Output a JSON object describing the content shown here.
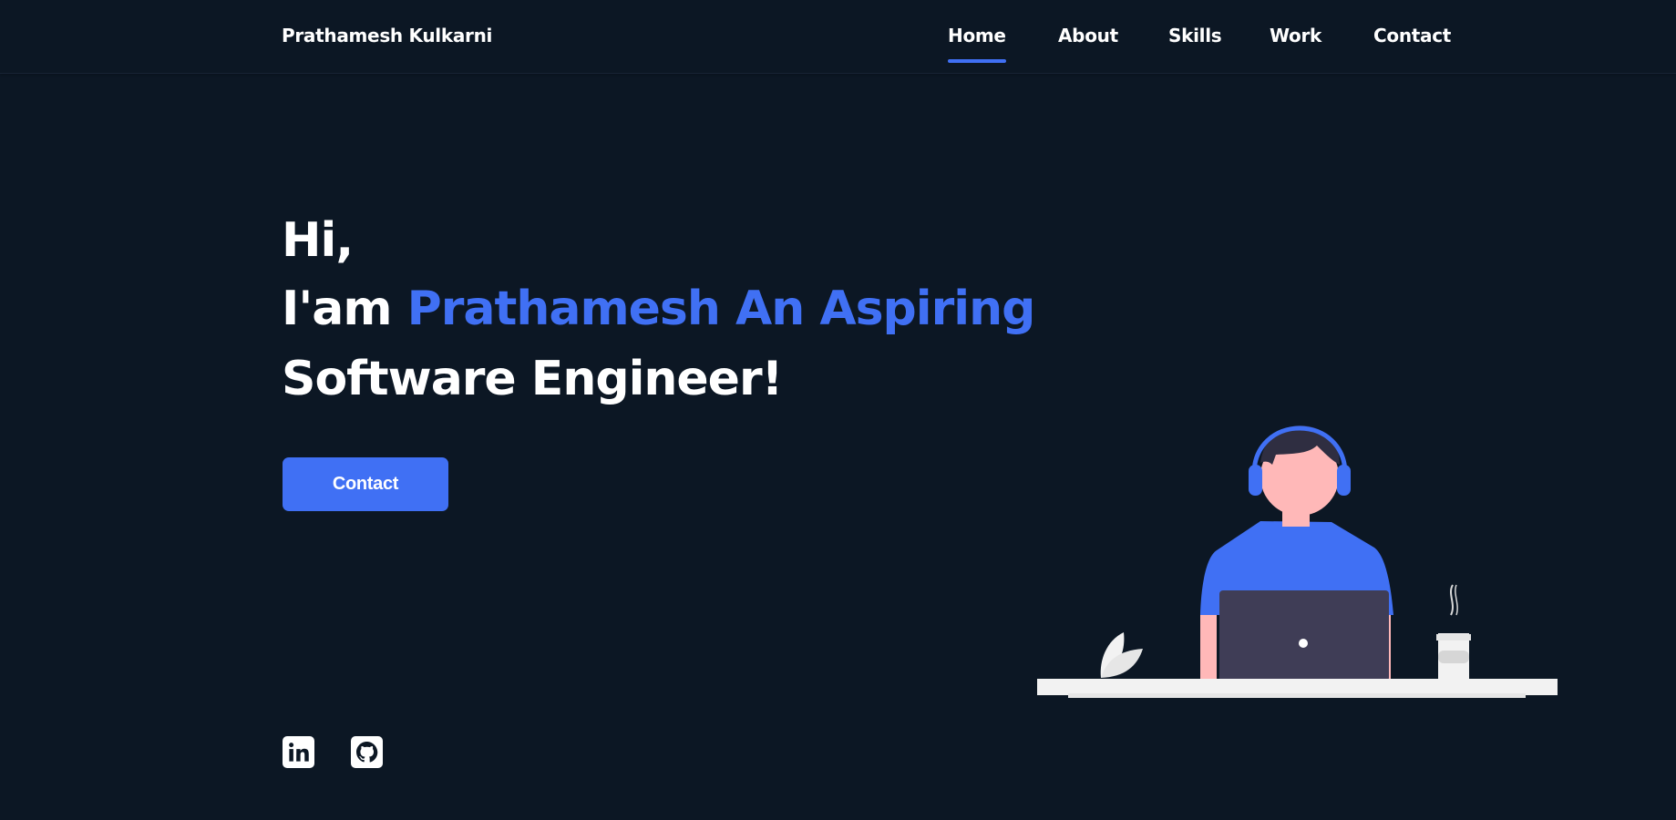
{
  "header": {
    "brand": "Prathamesh Kulkarni",
    "nav": [
      {
        "label": "Home",
        "active": true
      },
      {
        "label": "About",
        "active": false
      },
      {
        "label": "Skills",
        "active": false
      },
      {
        "label": "Work",
        "active": false
      },
      {
        "label": "Contact",
        "active": false
      }
    ]
  },
  "hero": {
    "greeting": "Hi,",
    "intro_prefix": "I'am ",
    "intro_highlight": "Prathamesh An Aspiring",
    "line3": "Software Engineer!",
    "contact_button": "Contact"
  },
  "social": {
    "linkedin_icon": "linkedin-icon",
    "github_icon": "github-icon"
  },
  "colors": {
    "background": "#0c1724",
    "accent": "#4070f4",
    "text": "#ffffff"
  }
}
